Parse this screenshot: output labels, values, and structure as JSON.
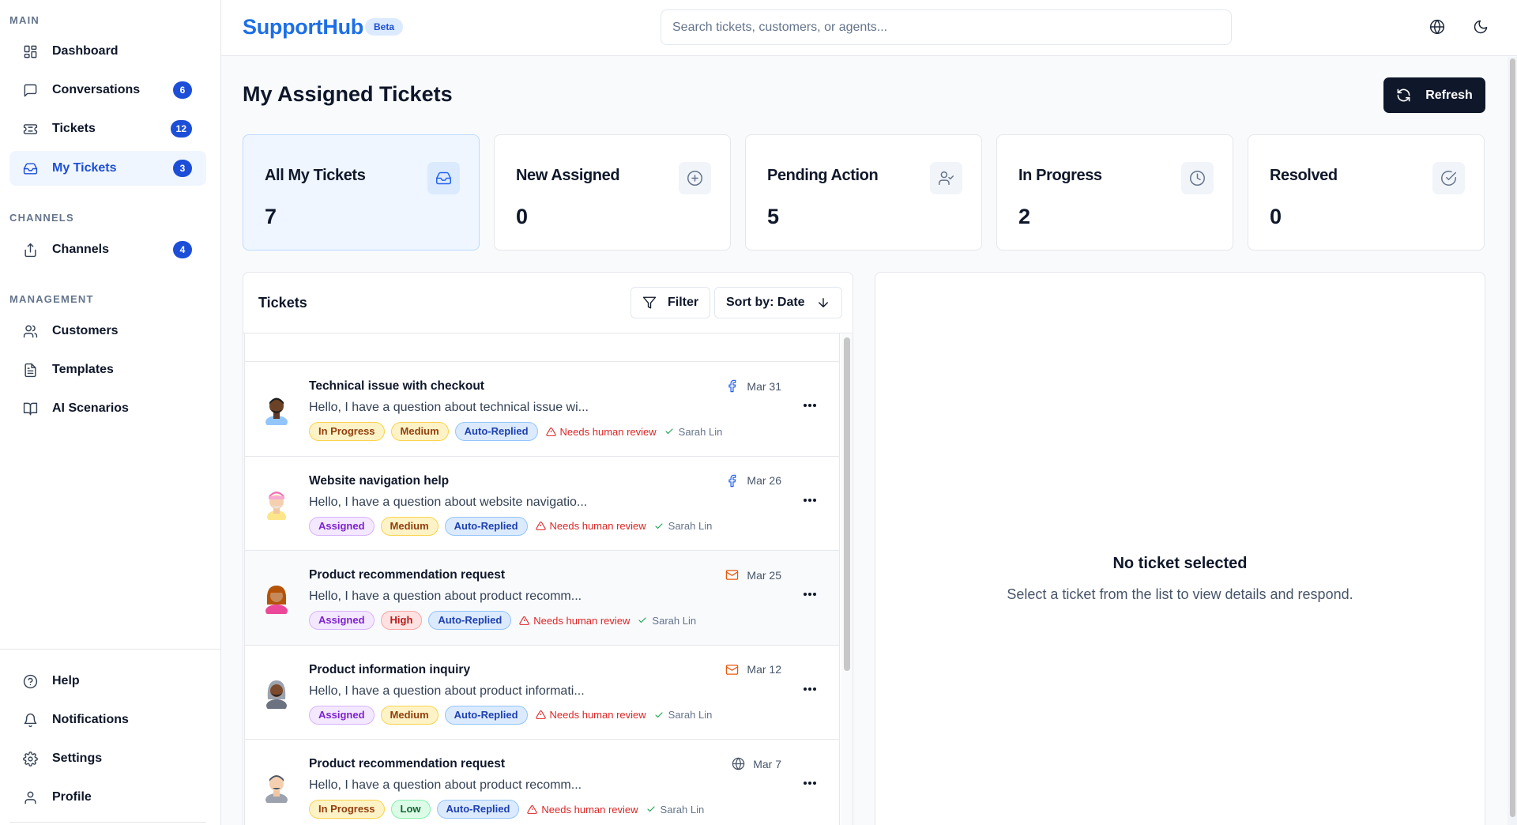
{
  "sidebar": {
    "sections": [
      {
        "title": "MAIN"
      },
      {
        "title": "CHANNELS"
      },
      {
        "title": "MANAGEMENT"
      }
    ],
    "items": {
      "dashboard": {
        "label": "Dashboard",
        "icon": "dashboard-icon"
      },
      "conversations": {
        "label": "Conversations",
        "count": "6",
        "icon": "chat-icon"
      },
      "tickets": {
        "label": "Tickets",
        "count": "12",
        "icon": "ticket-icon"
      },
      "my_tickets": {
        "label": "My Tickets",
        "count": "3",
        "icon": "inbox-icon",
        "active": true
      },
      "channels": {
        "label": "Channels",
        "count": "4",
        "icon": "share-icon"
      },
      "customers": {
        "label": "Customers",
        "icon": "users-icon"
      },
      "templates": {
        "label": "Templates",
        "icon": "file-text-icon"
      },
      "ai_scenarios": {
        "label": "AI Scenarios",
        "icon": "book-icon"
      },
      "help": {
        "label": "Help",
        "icon": "help-circle-icon"
      },
      "notifications": {
        "label": "Notifications",
        "icon": "bell-icon"
      },
      "settings": {
        "label": "Settings",
        "icon": "gear-icon"
      },
      "profile": {
        "label": "Profile",
        "icon": "user-icon"
      }
    }
  },
  "header": {
    "logo": "SupportHub",
    "badge": "Beta",
    "search_placeholder": "Search tickets, customers, or agents..."
  },
  "page": {
    "title": "My Assigned Tickets",
    "refresh_label": "Refresh"
  },
  "stats": [
    {
      "title": "All My Tickets",
      "value": "7",
      "icon": "inbox-icon"
    },
    {
      "title": "New Assigned",
      "value": "0",
      "icon": "plus-circle-icon"
    },
    {
      "title": "Pending Action",
      "value": "5",
      "icon": "user-check-icon"
    },
    {
      "title": "In Progress",
      "value": "2",
      "icon": "clock-icon"
    },
    {
      "title": "Resolved",
      "value": "0",
      "icon": "check-circle-icon"
    }
  ],
  "list": {
    "title": "Tickets",
    "filter_label": "Filter",
    "sort_label": "Sort by: Date"
  },
  "tickets": [
    {
      "title": "Technical issue with checkout",
      "preview": "Hello, I have a question about technical issue wi...",
      "date": "Mar 31",
      "channel": "facebook",
      "status": "In Progress",
      "priority": "Medium",
      "auto": "Auto-Replied",
      "review": "Needs human review",
      "agent": "Sarah Lin"
    },
    {
      "title": "Website navigation help",
      "preview": "Hello, I have a question about website navigatio...",
      "date": "Mar 26",
      "channel": "facebook",
      "status": "Assigned",
      "priority": "Medium",
      "auto": "Auto-Replied",
      "review": "Needs human review",
      "agent": "Sarah Lin"
    },
    {
      "title": "Product recommendation request",
      "preview": "Hello, I have a question about product recomm...",
      "date": "Mar 25",
      "channel": "email",
      "status": "Assigned",
      "priority": "High",
      "auto": "Auto-Replied",
      "review": "Needs human review",
      "agent": "Sarah Lin"
    },
    {
      "title": "Product information inquiry",
      "preview": "Hello, I have a question about product informati...",
      "date": "Mar 12",
      "channel": "email",
      "status": "Assigned",
      "priority": "Medium",
      "auto": "Auto-Replied",
      "review": "Needs human review",
      "agent": "Sarah Lin"
    },
    {
      "title": "Product recommendation request",
      "preview": "Hello, I have a question about product recomm...",
      "date": "Mar 7",
      "channel": "web",
      "status": "In Progress",
      "priority": "Low",
      "auto": "Auto-Replied",
      "review": "Needs human review",
      "agent": "Sarah Lin"
    }
  ],
  "detail": {
    "empty_title": "No ticket selected",
    "empty_subtitle": "Select a ticket from the list to view details and respond."
  },
  "colors": {
    "brand": "#1d6fe6",
    "active_nav": "#1d4ed8",
    "primary_button": "#0f172a",
    "review_red": "#dc2626"
  }
}
